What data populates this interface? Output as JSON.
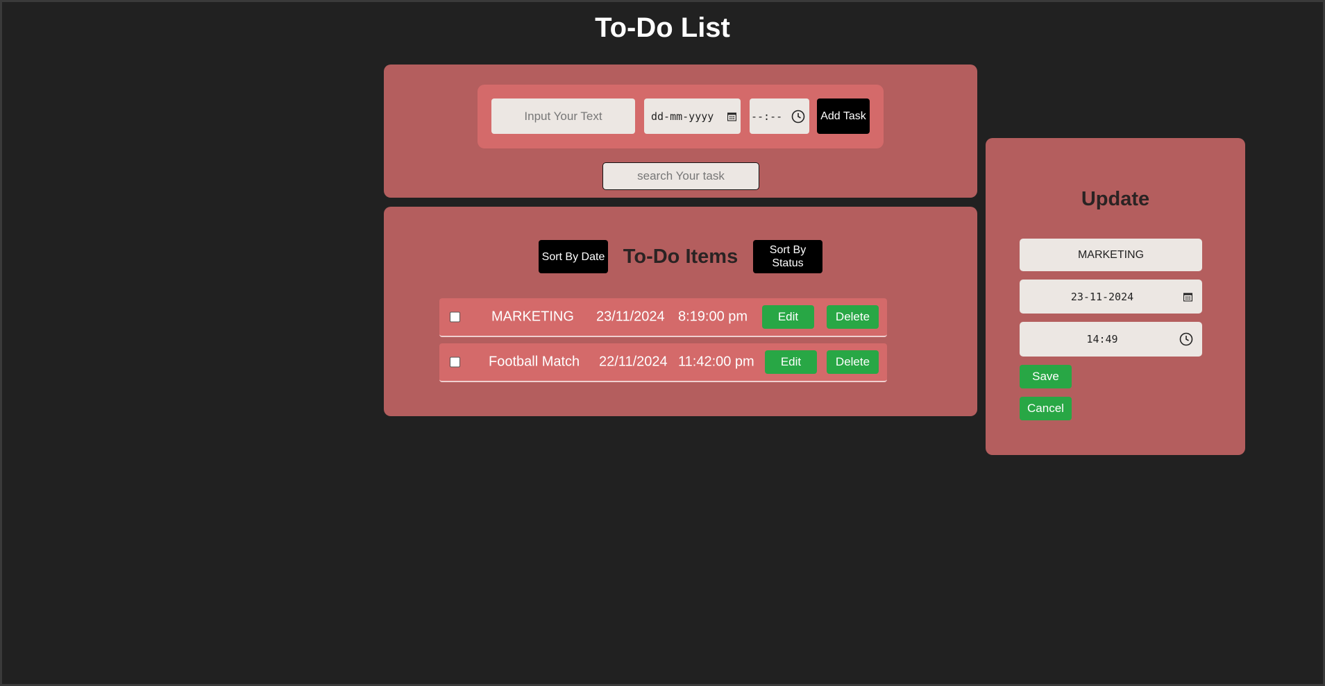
{
  "page": {
    "title": "To-Do List"
  },
  "add_form": {
    "task_placeholder": "Input Your Text",
    "date_placeholder": "dd-mm-yyyy",
    "time_placeholder": "--:--",
    "add_button": "Add Task"
  },
  "search": {
    "placeholder": "search Your task"
  },
  "items": {
    "title": "To-Do Items",
    "sort_by_date": "Sort By Date",
    "sort_by_status": "Sort By Status",
    "tasks": [
      {
        "text": "MARKETING",
        "date": "23/11/2024",
        "time": "8:19:00 pm",
        "checked": false,
        "edit_label": "Edit",
        "delete_label": "Delete"
      },
      {
        "text": "Football Match",
        "date": "22/11/2024",
        "time": "11:42:00 pm",
        "checked": false,
        "edit_label": "Edit",
        "delete_label": "Delete"
      }
    ]
  },
  "update": {
    "title": "Update",
    "name_value": "MARKETING",
    "date_value": "23-11-2024",
    "time_value": "14:49",
    "save_label": "Save",
    "cancel_label": "Cancel"
  },
  "colors": {
    "background": "#212121",
    "panel": "#b45e5e",
    "row": "#d46a6a",
    "green": "#28a745",
    "black_button": "#000000"
  },
  "icons": [
    "calendar-icon",
    "clock-icon"
  ]
}
